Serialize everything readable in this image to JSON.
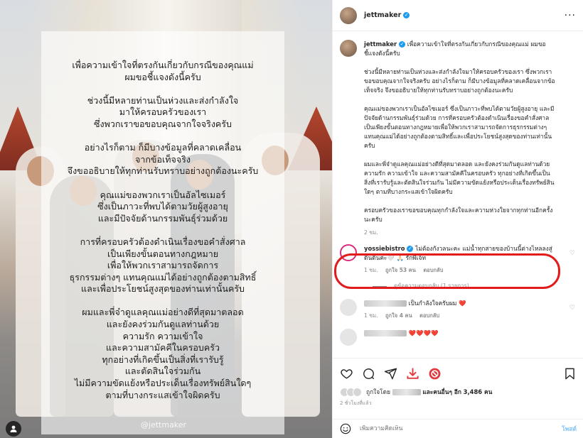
{
  "overlay_text": "เพื่อความเข้าใจที่ตรงกันเกี่ยวกับกรณีของคุณแม่\nผมขอชี้แจงดังนี้ครับ\n\nช่วงนี้มีหลายท่านเป็นห่วงและส่งกำลังใจ\nมาให้ครอบครัวของเรา\nซึ่งพวกเราขอขอบคุณจากใจจริงครับ\n\nอย่างไรก็ตาม ก็มีบางข้อมูลที่คลาดเคลื่อน\nจากข้อเท็จจริง\nจึงขออธิบายให้ทุกท่านรับทราบอย่างถูกต้องนะครับ\n\nคุณแม่ของพวกเราเป็นอัลไซเมอร์\nซึ่งเป็นภาวะที่พบได้ตามวัยผู้สูงอายุ\nและมีปัจจัยด้านกรรมพันธุ์ร่วมด้วย\n\nการที่ครอบครัวต้องดำเนินเรื่องขอคำสั่งศาล\nเป็นเพียงขั้นตอนทางกฎหมาย\nเพื่อให้พวกเราสามารถจัดการ\nธุรกรรมต่างๆ แทนคุณแม่ได้อย่างถูกต้องตามสิทธิ์\nและเพื่อประโยชน์สูงสุดของท่านเท่านั้นครับ\n\nผมและพี่จ๋าดูแลคุณแม่อย่างดีที่สุดมาตลอด\nและยังคงร่วมกันดูแลท่านด้วย\nความรัก ความเข้าใจ\nและความสามัคคีในครอบครัว\nทุกอย่างที่เกิดขึ้นเป็นสิ่งที่เรารับรู้\nและตัดสินใจร่วมกัน\nไม่มีความขัดแย้งหรือประเด็นเรื่องทรัพย์สินใดๆ\nตามที่บางกระแสเข้าใจผิดครับ",
  "watermark": "@jettmaker",
  "header": {
    "username": "jettmaker",
    "more": "···"
  },
  "caption": {
    "username": "jettmaker",
    "first_line": "เพื่อความเข้าใจที่ตรงกันเกี่ยวกับกรณีของคุณแม่ ผมขอชี้แจงดังนี้ครับ",
    "paragraphs": [
      "ช่วงนี้มีหลายท่านเป็นห่วงและส่งกำลังใจมาให้ครอบครัวของเรา ซึ่งพวกเราขอขอบคุณจากใจจริงครับ อย่างไรก็ตาม ก็มีบางข้อมูลที่คลาดเคลื่อนจากข้อเท็จจริง จึงขออธิบายให้ทุกท่านรับทราบอย่างถูกต้องนะครับ",
      "คุณแม่ของพวกเราเป็นอัลไซเมอร์ ซึ่งเป็นภาวะที่พบได้ตามวัยผู้สูงอายุ และมีปัจจัยด้านกรรมพันธุ์ร่วมด้วย การที่ครอบครัวต้องดำเนินเรื่องขอคำสั่งศาล เป็นเพียงขั้นตอนทางกฎหมายเพื่อให้พวกเราสามารถจัดการธุรกรรมต่างๆ แทนคุณแม่ได้อย่างถูกต้องตามสิทธิ์และเพื่อประโยชน์สูงสุดของท่านเท่านั้นครับ",
      "ผมและพี่จ๋าดูแลคุณแม่อย่างดีที่สุดมาตลอด และยังคงร่วมกันดูแลท่านด้วยความรัก ความเข้าใจ และความสามัคคีในครอบครัว ทุกอย่างที่เกิดขึ้นเป็นสิ่งที่เรารับรู้และตัดสินใจร่วมกัน ไม่มีความขัดแย้งหรือประเด็นเรื่องทรัพย์สินใดๆ ตามที่บางกระแสเข้าใจผิดครับ",
      "ครอบครัวของเราขอขอบคุณทุกกำลังใจและความห่วงใยจากทุกท่านอีกครั้งนะครับ"
    ],
    "time": "2 ชม."
  },
  "comments": [
    {
      "username": "yossiebistro",
      "text": "ไม่ต้องกังวลนะคะ แม่น้ำทุกสายของบ้านนี้ต่างไหลลงสู่ดินดินค่ะ🤍 🙏🏻 รักพี่เจ็ท",
      "time": "1 ชม.",
      "likes": "ถูกใจ 53 คน",
      "reply": "ตอบกลับ",
      "view_replies": "ดูข้อความตอบกลับ (1 รายการ)"
    },
    {
      "text": "เป็นกำลังใจครับผม ❤️",
      "time": "1 ชม.",
      "likes": "ถูกใจ 4 คน",
      "reply": "ตอบกลับ"
    },
    {
      "text": "❤️❤️❤️❤️",
      "time": "",
      "likes": "",
      "reply": ""
    }
  ],
  "likes_summary": {
    "prefix": "ถูกใจโดย",
    "suffix": "และคนอื่นๆ อีก",
    "count": "3,486 คน"
  },
  "post_age": "2 ชั่วโมงที่แล้ว",
  "add_comment": {
    "placeholder": "เพิ่มความคิดเห็น",
    "post": "โพสต์"
  },
  "colors": {
    "verified": "#1d9bf0",
    "highlight": "#e21b1b",
    "like": "#ed4956",
    "download": "#e0393e"
  }
}
